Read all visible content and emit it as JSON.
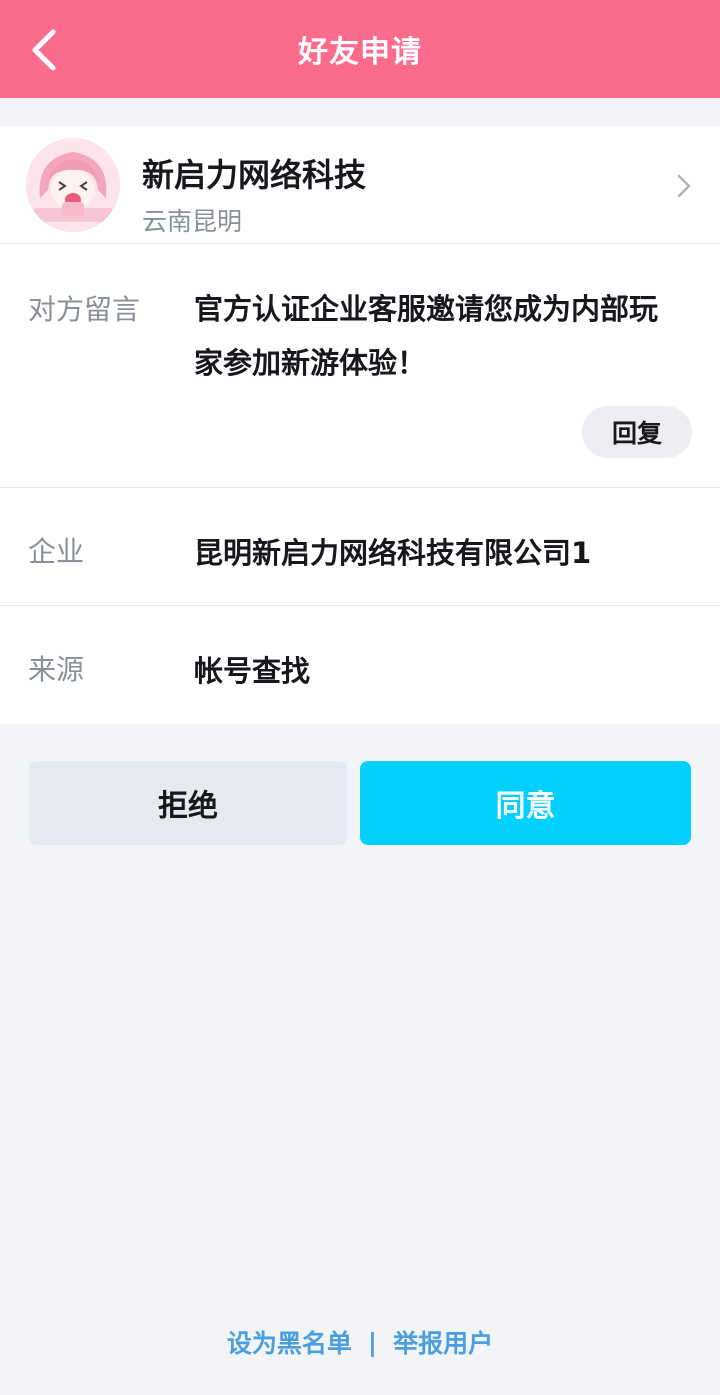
{
  "header": {
    "title": "好友申请",
    "back_icon": "chevron-left-icon",
    "color": "#fb6c8c"
  },
  "profile": {
    "name": "新启力网络科技",
    "location": "云南昆明",
    "avatar_icon": "anime-girl-avatar",
    "chevron_icon": "chevron-right-icon"
  },
  "message": {
    "label": "对方留言",
    "text": "官方认证企业客服邀请您成为内部玩家参加新游体验！",
    "reply_label": "回复"
  },
  "company": {
    "label": "企业",
    "value": "昆明新启力网络科技有限公司1"
  },
  "source": {
    "label": "来源",
    "value": "帐号查找"
  },
  "actions": {
    "reject_label": "拒绝",
    "accept_label": "同意",
    "accept_color": "#02d1ff"
  },
  "footer": {
    "blacklist_label": "设为黑名单",
    "separator": "|",
    "report_label": "举报用户",
    "link_color": "#4a9fdc"
  }
}
